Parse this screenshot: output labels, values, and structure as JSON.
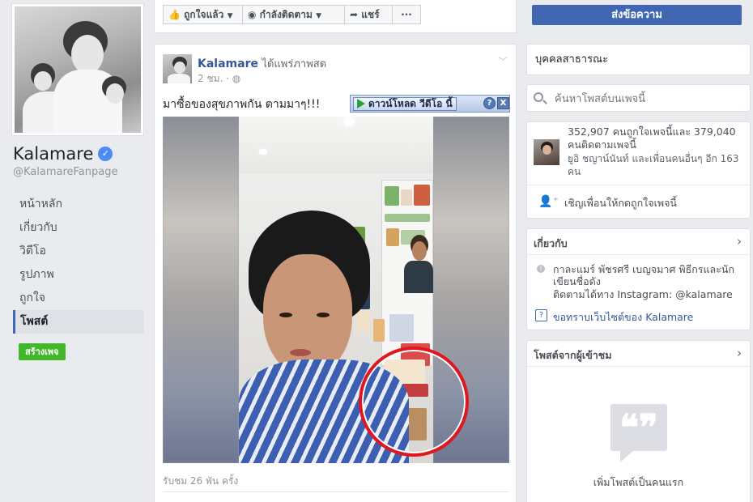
{
  "page": {
    "name": "Kalamare",
    "handle": "@KalamareFanpage"
  },
  "left_nav": {
    "items": [
      {
        "label": "หน้าหลัก"
      },
      {
        "label": "เกี่ยวกับ"
      },
      {
        "label": "วิดีโอ"
      },
      {
        "label": "รูปภาพ"
      },
      {
        "label": "ถูกใจ"
      },
      {
        "label": "โพสต์",
        "active": true
      }
    ],
    "create_page": "สร้างเพจ"
  },
  "action_bar": {
    "liked": "ถูกใจแล้ว",
    "following": "กำลังติดตาม",
    "share": "แชร์",
    "more": "···",
    "send_message": "ส่งข้อความ"
  },
  "post": {
    "author": "Kalamare",
    "action": "ได้แพร่ภาพสด",
    "time": "2 ชม.",
    "text": "มาซื้อของสุขภาพกัน ตามมาๆ!!!",
    "download_bar": {
      "label": "ดาวน์โหลด วีดีโอ นี้",
      "help": "?",
      "close": "X"
    },
    "views": "รับชม 26 พัน ครั้ง"
  },
  "sidebar": {
    "category": "บุคคลสาธารณะ",
    "search_placeholder": "ค้นหาโพสต์บนเพจนี้",
    "likes_text": "352,907 คนถูกใจเพจนี้และ 379,040 คนติดตามเพจนี้",
    "likes_friends": "ยูอิ ชญาน์นันท์ และเพื่อนคนอื่นๆ อีก 163 คน",
    "invite": "เชิญเพื่อนให้กดถูกใจเพจนี้",
    "about_title": "เกี่ยวกับ",
    "about_desc": "กาละแมร์ พัชรศรี เบญจมาศ พิธีกรและนักเขียนชื่อดัง",
    "about_ig": "ติดตามได้ทาง Instagram: @kalamare",
    "about_site": "ขอทราบเว็บไซต์ของ Kalamare",
    "visitor_title": "โพสต์จากผู้เข้าชม",
    "visitor_empty": "เพิ่มโพสต์เป็นคนแรก"
  },
  "colors": {
    "brand_blue": "#4267b2",
    "link_blue": "#365899",
    "green": "#42b72a",
    "highlight_red": "#e0171f"
  },
  "icons": [
    "verified-badge-icon",
    "like-thumb-icon",
    "rss-follow-icon",
    "share-arrow-icon",
    "search-icon",
    "invite-friend-icon",
    "info-icon",
    "question-icon",
    "quote-bubble-icon"
  ]
}
